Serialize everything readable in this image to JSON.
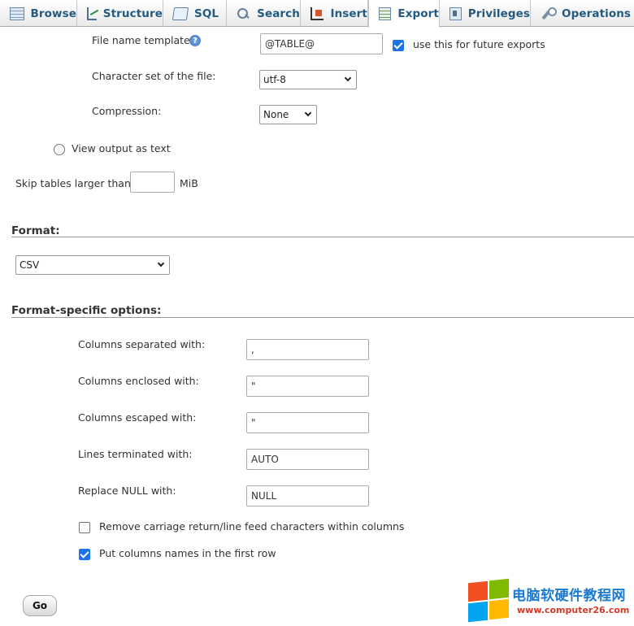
{
  "tabs": [
    {
      "label": "Browse",
      "icon": "browse-icon"
    },
    {
      "label": "Structure",
      "icon": "structure-icon"
    },
    {
      "label": "SQL",
      "icon": "sql-icon"
    },
    {
      "label": "Search",
      "icon": "search-icon"
    },
    {
      "label": "Insert",
      "icon": "insert-icon"
    },
    {
      "label": "Export",
      "icon": "export-icon",
      "active": true
    },
    {
      "label": "Privileges",
      "icon": "privileges-icon"
    },
    {
      "label": "Operations",
      "icon": "operations-icon"
    }
  ],
  "output": {
    "file_name_template_label": "File name template:",
    "help_glyph": "?",
    "file_name_template_value": "@TABLE@",
    "future_exports_label": "use this for future exports",
    "future_exports_checked": true,
    "charset_label": "Character set of the file:",
    "charset_value": "utf-8",
    "compression_label": "Compression:",
    "compression_value": "None",
    "view_as_text_label": "View output as text",
    "view_as_text_selected": false,
    "skip_tables_label": "Skip tables larger than",
    "skip_tables_value": "",
    "skip_tables_unit": "MiB"
  },
  "format": {
    "title": "Format:",
    "value": "CSV"
  },
  "format_options": {
    "title": "Format-specific options:",
    "separated_label": "Columns separated with:",
    "separated_value": ",",
    "enclosed_label": "Columns enclosed with:",
    "enclosed_value": "\"",
    "escaped_label": "Columns escaped with:",
    "escaped_value": "\"",
    "lines_label": "Lines terminated with:",
    "lines_value": "AUTO",
    "null_label": "Replace NULL with:",
    "null_value": "NULL",
    "remove_crlf_label": "Remove carriage return/line feed characters within columns",
    "remove_crlf_checked": false,
    "col_names_label": "Put columns names in the first row",
    "col_names_checked": true
  },
  "go_button": "Go",
  "watermark": {
    "title": "电脑软硬件教程网",
    "url": "www.computer26.com",
    "colors": [
      "#f25022",
      "#7fba00",
      "#00a4ef",
      "#ffb900"
    ]
  },
  "accent_color": "#235a81"
}
